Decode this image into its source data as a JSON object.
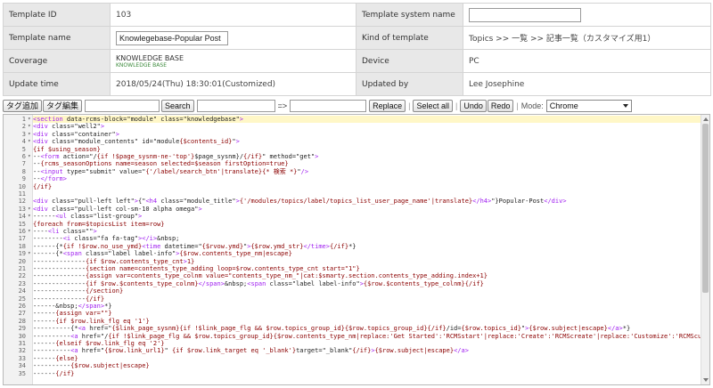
{
  "info": {
    "template_id_label": "Template ID",
    "template_id_value": "103",
    "template_system_name_label": "Template system name",
    "template_system_name_value": "",
    "template_name_label": "Template name",
    "template_name_value": "Knowlegebase-Popular Post",
    "kind_label": "Kind of template",
    "kind_value": "Topics >> 一覧 >> 記事一覧（カスタマイズ用1）",
    "coverage_label": "Coverage",
    "coverage_main": "KNOWLEDGE BASE",
    "coverage_sub": "KNOWLEDGE BASE",
    "device_label": "Device",
    "device_value": "PC",
    "update_time_label": "Update time",
    "update_time_value": "2018/05/24(Thu) 18:30:01(Customized)",
    "updated_by_label": "Updated by",
    "updated_by_value": "Lee Josephine"
  },
  "toolbar": {
    "tag_add": "タグ追加",
    "tag_edit": "タグ編集",
    "search": "Search",
    "arrow": "=>",
    "replace": "Replace",
    "select_all": "Select all",
    "undo": "Undo",
    "redo": "Redo",
    "separator": "|",
    "mode_label": "Mode:",
    "mode_value": "Chrome",
    "search_value": "",
    "find_value": "",
    "replace_value": ""
  },
  "editor": {
    "lines": [
      {
        "n": "1",
        "fold": "▾",
        "text": "<section data-rcms-block=\"module\" class=\"knowledgebase\">"
      },
      {
        "n": "2",
        "fold": "▾",
        "text": "<div class=\"well2\">"
      },
      {
        "n": "3",
        "fold": "▾",
        "text": "<div class=\"container\">"
      },
      {
        "n": "4",
        "fold": "▾",
        "text": "<div class=\"module_contents\" id=\"module{$contents_id}\">"
      },
      {
        "n": "5",
        "fold": "",
        "text": "{if $using_season}"
      },
      {
        "n": "6",
        "fold": "▾",
        "text": "--<form action=\"/{if !$page_sysnm-ne-'top'}$page_sysnm}/{/if}\" method=\"get\">"
      },
      {
        "n": "7",
        "fold": "",
        "text": "--{rcms_seasonOptions name=season selected=$season firstOption=true}"
      },
      {
        "n": "8",
        "fold": "",
        "text": "--<input type=\"submit\" value=\"{'/label/search_btn'|translate}{* 検索 *}\"/>"
      },
      {
        "n": "9",
        "fold": "",
        "text": "--</form>"
      },
      {
        "n": "10",
        "fold": "",
        "text": "{/if}"
      },
      {
        "n": "11",
        "fold": "",
        "text": ""
      },
      {
        "n": "12",
        "fold": "",
        "text": "<div class=\"pull-left left\">{\"<h4 class=\"module_title\">{'/modules/topics/label/topics_list_user_page_name'|translate}</h4>\"}Popular-Post</div>"
      },
      {
        "n": "13",
        "fold": "▾",
        "text": "<div class=\"pull-left col-sm-10 alpha omega\">"
      },
      {
        "n": "14",
        "fold": "▾",
        "text": "------<ul class=\"list-group\">"
      },
      {
        "n": "15",
        "fold": "",
        "text": "{foreach from=$topicsList item=row}"
      },
      {
        "n": "16",
        "fold": "▾",
        "text": "----<li class=\"\">"
      },
      {
        "n": "17",
        "fold": "",
        "text": "--------<i class=\"fa fa-tag\"></i>&nbsp;"
      },
      {
        "n": "18",
        "fold": "",
        "text": "------{*{if !$row.no_use_ymd}<time datetime=\"{$rvow.ymd}\">{$row.ymd_str}</time>{/if}*}"
      },
      {
        "n": "19",
        "fold": "▾",
        "text": "------{*<span class=\"label label-info\">{$row.contents_type_nm|escape}"
      },
      {
        "n": "20",
        "fold": "",
        "text": "--------------{if $row.contents_type_cnt>1}"
      },
      {
        "n": "21",
        "fold": "",
        "text": "--------------{section name=contents_type_adding loop=$row.contents_type_cnt start=\"1\"}"
      },
      {
        "n": "22",
        "fold": "",
        "text": "--------------{assign var=contents_type_colnm value=\"contents_type_nm_\"|cat:$smarty.section.contents_type_adding.index+1}"
      },
      {
        "n": "23",
        "fold": "",
        "text": "--------------{if $row.$contents_type_colnm}</span>&nbsp;<span class=\"label label-info\">{$row.$contents_type_colnm}{/if}"
      },
      {
        "n": "24",
        "fold": "",
        "text": "--------------{/section}"
      },
      {
        "n": "25",
        "fold": "",
        "text": "--------------{/if}"
      },
      {
        "n": "26",
        "fold": "",
        "text": "------&nbsp;</span>*}"
      },
      {
        "n": "27",
        "fold": "",
        "text": "------{assign var=\"\"}"
      },
      {
        "n": "28",
        "fold": "",
        "text": "------{if $row.link_flg eq '1'}"
      },
      {
        "n": "29",
        "fold": "",
        "text": "----------{*<a href=\"{$link_page_sysnm}{if !$link_page_flg && $row.topics_group_id}{$row.topics_group_id}{/if}/id={$row.topics_id}\">{$row.subject|escape}</a>*}"
      },
      {
        "n": "30",
        "fold": "",
        "text": "----------<a href=\"/{if !$link_page_flg && $row.topics_group_id}{$row.contents_type_nm|replace:'Get Started':'RCMSstart'|replace:'Create':'RCMScreate'|replace:'Customize':'RCMScustomize'}{/if}"
      },
      {
        "n": "31",
        "fold": "",
        "text": "------{elseif $row.link_flg eq '2'}"
      },
      {
        "n": "32",
        "fold": "",
        "text": "----------<a href=\"{$row.link_url1}\" {if $row.link_target eq '_blank'}target=\"_blank\"{/if}>{$row.subject|escape}</a>"
      },
      {
        "n": "33",
        "fold": "",
        "text": "------{else}"
      },
      {
        "n": "34",
        "fold": "",
        "text": "----------{$row.subject|escape}"
      },
      {
        "n": "35",
        "fold": "",
        "text": "------{/if}"
      }
    ]
  }
}
